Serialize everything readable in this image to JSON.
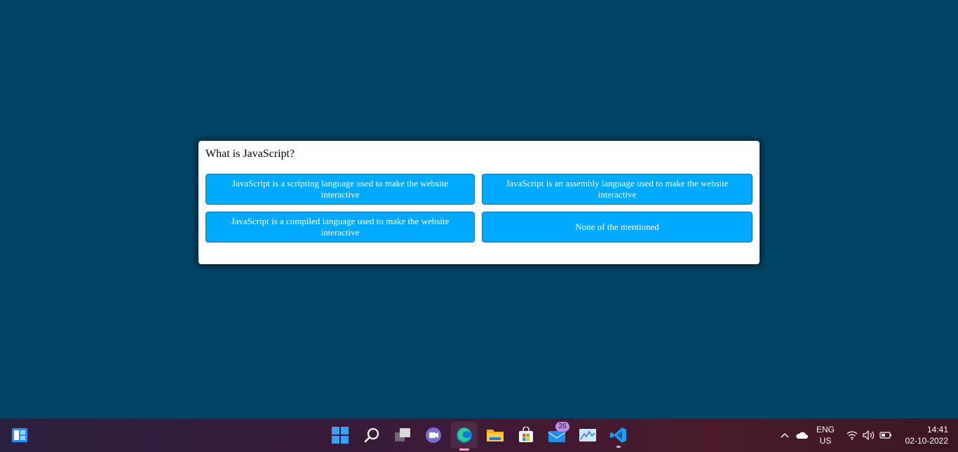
{
  "quiz": {
    "question": "What is JavaScript?",
    "answers": [
      "JavaScript is a scripting language used to make the website interactive",
      "JavaScript is an assembly language used to make the website interactive",
      "JavaScript is a compiled language used to make the website interactive",
      "None of the mentioned"
    ]
  },
  "colors": {
    "page_background": "#004466",
    "answer_button": "#00aaff"
  },
  "taskbar": {
    "icons": [
      "widgets-icon",
      "windows-start-icon",
      "search-icon",
      "task-view-icon",
      "chat-icon",
      "edge-browser-icon",
      "file-explorer-icon",
      "microsoft-store-icon",
      "mail-icon",
      "photos-icon",
      "vscode-icon"
    ],
    "mail_badge": "26",
    "tray": {
      "language_primary": "ENG",
      "language_secondary": "US",
      "time": "14:41",
      "date": "02-10-2022"
    }
  }
}
